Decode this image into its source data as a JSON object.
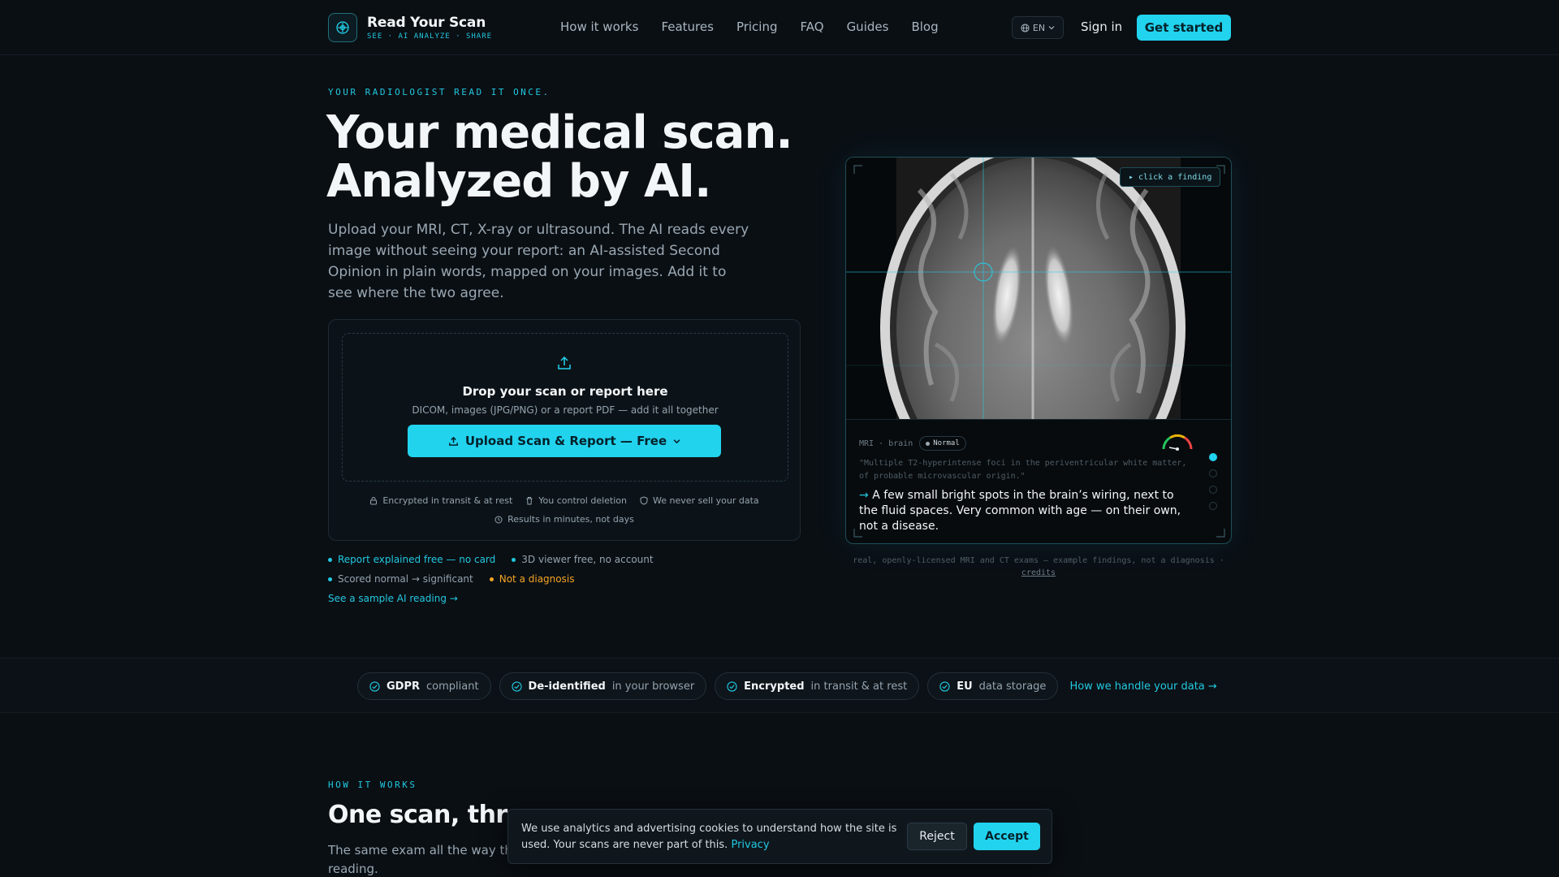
{
  "brand": {
    "name": "Read Your Scan",
    "tagline": "SEE · AI ANALYZE · SHARE"
  },
  "nav": {
    "links": [
      "How it works",
      "Features",
      "Pricing",
      "FAQ",
      "Guides",
      "Blog"
    ],
    "lang": "EN",
    "signin": "Sign in",
    "cta": "Get started"
  },
  "hero": {
    "eyebrow": "YOUR RADIOLOGIST READ IT ONCE.",
    "headline_1": "Your medical scan.",
    "headline_2": "Analyzed by AI.",
    "sub": "Upload your MRI, CT, X-ray or ultrasound. The AI reads every image without seeing your report: an AI-assisted Second Opinion in plain words, mapped on your images. Add it to see where the two agree."
  },
  "upload": {
    "title": "Drop your scan or report here",
    "subtitle": "DICOM, images (JPG/PNG) or a report PDF — add it all together",
    "button": "Upload Scan & Report — Free",
    "trust": [
      "Encrypted in transit & at rest",
      "You control deletion",
      "We never sell your data",
      "Results in minutes, not days"
    ]
  },
  "bullets": {
    "b1": "Report explained free — no card",
    "b2": "3D viewer free, no account",
    "b3": "Scored normal → significant",
    "b4": "Not a diagnosis"
  },
  "sample_link": "See a sample AI reading →",
  "viewer": {
    "tag": "▸ click a finding",
    "modality": "MRI · brain",
    "badge": "Normal",
    "quote": "\"Multiple T2-hyperintense foci in the periventricular white matter, of probable microvascular origin.\"",
    "arrow": "→",
    "plain": "A few small bright spots in the brain’s wiring, next to the fluid spaces. Very common with age — on their own, not a disease.",
    "caption": "real, openly-licensed MRI and CT exams — example findings, not a diagnosis ·",
    "credits": "credits"
  },
  "compliance": {
    "chips": [
      {
        "bold": "GDPR",
        "rest": "compliant"
      },
      {
        "bold": "De-identified",
        "rest": "in your browser"
      },
      {
        "bold": "Encrypted",
        "rest": "in transit & at rest"
      },
      {
        "bold": "EU",
        "rest": "data storage"
      }
    ],
    "link": "How we handle your data →"
  },
  "how_it_works": {
    "eyebrow": "HOW IT WORKS",
    "title": "One scan, three",
    "sub": "The same exam all the way thr... and it comes back with a second reading."
  },
  "cookie": {
    "text": "We use analytics and advertising cookies to understand how the site is used. Your scans are never part of this.",
    "privacy": "Privacy",
    "reject": "Reject",
    "accept": "Accept"
  },
  "colors": {
    "accent": "#22d3ee",
    "background": "#0a0f14",
    "warning": "#f5a524"
  }
}
